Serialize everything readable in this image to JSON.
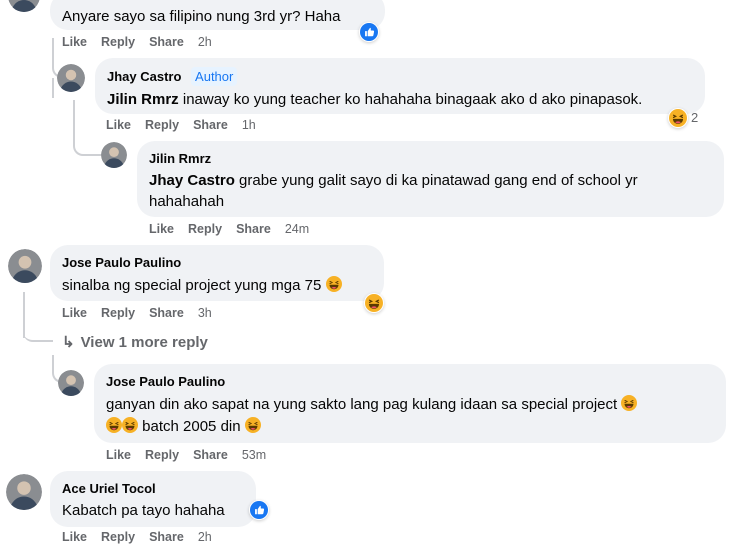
{
  "comments": [
    {
      "text": "Anyare sayo sa filipino nung 3rd yr? Haha",
      "actions": {
        "like": "Like",
        "reply": "Reply",
        "share": "Share",
        "time": "2h"
      },
      "reaction": "like"
    },
    {
      "name": "Jhay Castro",
      "badge": "Author",
      "mention": "Jilin Rmrz",
      "text": " inaway ko yung teacher ko hahahaha binagaak ako d ako pinapasok.",
      "actions": {
        "like": "Like",
        "reply": "Reply",
        "share": "Share",
        "time": "1h"
      },
      "reaction": "haha",
      "reaction_count": "2"
    },
    {
      "name": "Jilin Rmrz",
      "mention": "Jhay Castro",
      "text_line1": " grabe yung galit sayo di ka pinatawad gang end of school yr",
      "text_line2": "hahahahah",
      "actions": {
        "like": "Like",
        "reply": "Reply",
        "share": "Share",
        "time": "24m"
      }
    },
    {
      "name": "Jose Paulo Paulino",
      "text": "sinalba ng special project yung mga 75",
      "actions": {
        "like": "Like",
        "reply": "Reply",
        "share": "Share",
        "time": "3h"
      },
      "reaction": "haha"
    },
    {
      "view_more": "View 1 more reply"
    },
    {
      "name": "Jose Paulo Paulino",
      "text_line1": "ganyan din ako sapat na yung sakto lang pag kulang idaan sa special project",
      "text_line2": "batch 2005 din",
      "actions": {
        "like": "Like",
        "reply": "Reply",
        "share": "Share",
        "time": "53m"
      }
    },
    {
      "name": "Ace Uriel Tocol",
      "text": "Kabatch pa tayo hahaha",
      "actions": {
        "like": "Like",
        "reply": "Reply",
        "share": "Share",
        "time": "2h"
      },
      "reaction": "like"
    }
  ],
  "colors": {
    "bubble": "#f0f2f5",
    "secondary_text": "#65676b",
    "like_blue": "#1877f2",
    "haha_yellow": "#f7b125"
  }
}
